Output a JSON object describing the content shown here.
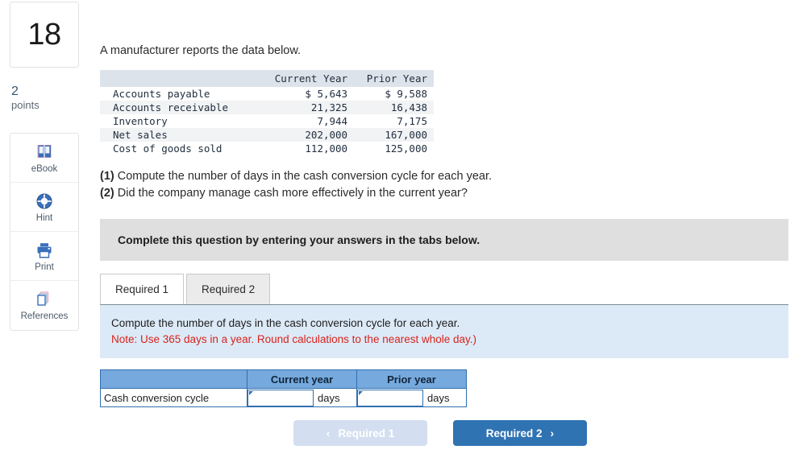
{
  "sidebar": {
    "question_number": "18",
    "points_value": "2",
    "points_label": "points",
    "tools": [
      {
        "id": "ebook",
        "label": "eBook",
        "icon": "book-icon"
      },
      {
        "id": "hint",
        "label": "Hint",
        "icon": "lifering-icon"
      },
      {
        "id": "print",
        "label": "Print",
        "icon": "printer-icon"
      },
      {
        "id": "references",
        "label": "References",
        "icon": "pages-stack-icon"
      }
    ]
  },
  "main": {
    "intro": "A manufacturer reports the data below.",
    "data_table": {
      "columns": [
        "",
        "Current Year",
        "Prior Year"
      ],
      "rows": [
        {
          "label": "Accounts payable",
          "current": "$ 5,643",
          "prior": "$ 9,588"
        },
        {
          "label": "Accounts receivable",
          "current": "21,325",
          "prior": "16,438"
        },
        {
          "label": "Inventory",
          "current": "7,944",
          "prior": "7,175"
        },
        {
          "label": "Net sales",
          "current": "202,000",
          "prior": "167,000"
        },
        {
          "label": "Cost of goods sold",
          "current": "112,000",
          "prior": "125,000"
        }
      ]
    },
    "requirements": [
      {
        "num": "(1)",
        "text": "Compute the number of days in the cash conversion cycle for each year."
      },
      {
        "num": "(2)",
        "text": "Did the company manage cash more effectively in the current year?"
      }
    ],
    "gray_banner": "Complete this question by entering your answers in the tabs below.",
    "tabs": [
      {
        "label": "Required 1",
        "active": true
      },
      {
        "label": "Required 2",
        "active": false
      }
    ],
    "blue_panel": {
      "line1": "Compute the number of days in the cash conversion cycle for each year.",
      "line2": "Note: Use 365 days in a year. Round calculations to the nearest whole day.)"
    },
    "answer_table": {
      "headers": [
        "",
        "Current year",
        "Prior year"
      ],
      "row_label": "Cash conversion cycle",
      "current_value": "",
      "prior_value": "",
      "unit": "days"
    },
    "nav": {
      "prev_label": "Required 1",
      "prev_chevron": "‹",
      "next_label": "Required 2",
      "next_chevron": "›"
    }
  },
  "colors": {
    "accent_blue": "#2f73b3",
    "header_blue": "#76a9dd",
    "panel_blue": "#dceaf7",
    "disabled_blue": "#d3dff0",
    "banner_gray": "#dfdfdf",
    "note_red": "#d9221c"
  }
}
